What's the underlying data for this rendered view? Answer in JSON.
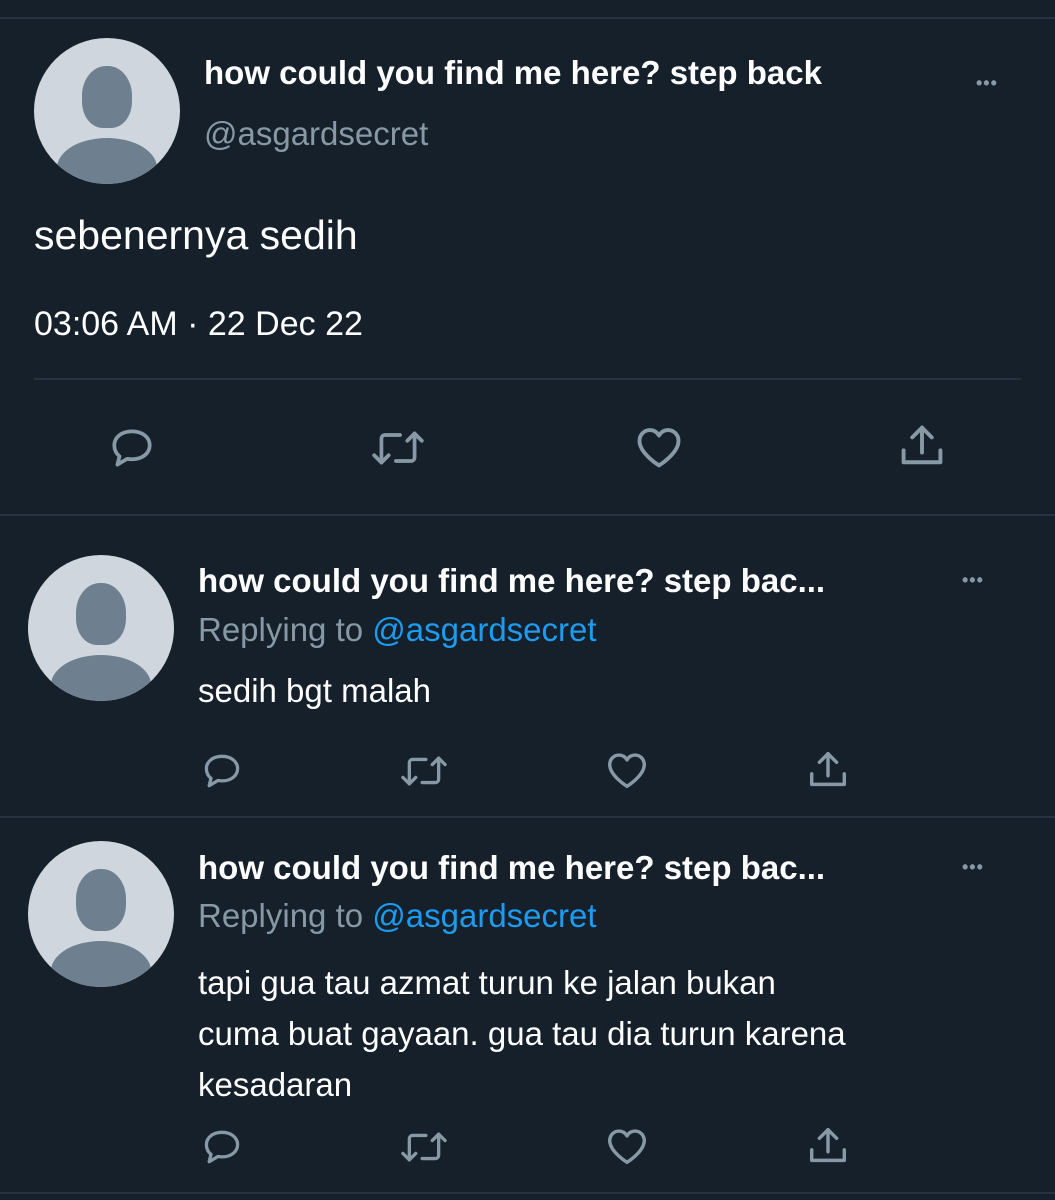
{
  "main_tweet": {
    "display_name": "how could you find me here? step back",
    "handle": "@asgardsecret",
    "text": "sebenernya sedih",
    "time": "03:06 AM",
    "dot": "·",
    "date": "22 Dec 22",
    "more_label": "•••"
  },
  "replies": [
    {
      "display_name": "how could you find me here? step bac...",
      "replying_prefix": "Replying to",
      "replying_handle": "@asgardsecret",
      "text": "sedih bgt malah",
      "more_label": "•••"
    },
    {
      "display_name": "how could you find me here? step bac...",
      "replying_prefix": "Replying to",
      "replying_handle": "@asgardsecret",
      "text_lines": [
        "tapi gua tau azmat turun ke jalan bukan",
        "cuma buat gayaan. gua tau dia turun karena",
        "kesadaran"
      ],
      "more_label": "•••"
    }
  ],
  "icons": [
    "reply-icon",
    "retweet-icon",
    "like-icon",
    "share-icon"
  ],
  "colors": {
    "background": "#15202b",
    "divider": "#253341",
    "muted": "#8899a6",
    "link": "#1d9bf0",
    "avatar_bg": "#cfd6dd",
    "avatar_fg": "#6e7f90"
  }
}
